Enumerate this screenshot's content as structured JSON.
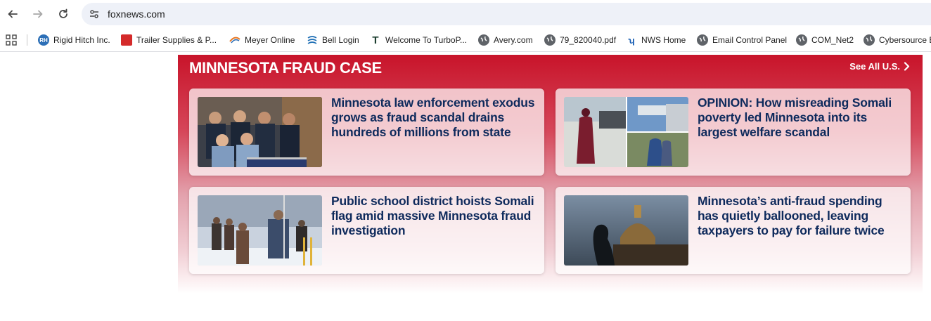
{
  "browser": {
    "url": "foxnews.com",
    "bookmarks": [
      {
        "label": "Rigid Hitch Inc.",
        "icon": "rigid-hitch-favicon",
        "color": "#2c6fb7"
      },
      {
        "label": "Trailer Supplies & P...",
        "icon": "trailer-supplies-favicon",
        "color": "#d42a2a"
      },
      {
        "label": "Meyer Online",
        "icon": "meyer-favicon",
        "color": "#e87722"
      },
      {
        "label": "Bell Login",
        "icon": "bell-favicon",
        "color": "#1f6fb5"
      },
      {
        "label": "Welcome To TurboP...",
        "icon": "turbo-favicon",
        "color": "#1b3d2f"
      },
      {
        "label": "Avery.com",
        "icon": "globe-icon",
        "color": "#5f6368"
      },
      {
        "label": "79_820040.pdf",
        "icon": "globe-icon",
        "color": "#5f6368"
      },
      {
        "label": "NWS Home",
        "icon": "nws-favicon",
        "color": "#1a5fb4"
      },
      {
        "label": "Email Control Panel",
        "icon": "globe-icon",
        "color": "#5f6368"
      },
      {
        "label": "COM_Net2",
        "icon": "globe-icon",
        "color": "#5f6368"
      },
      {
        "label": "Cybersource B",
        "icon": "globe-icon",
        "color": "#5f6368"
      }
    ]
  },
  "section": {
    "title": "MINNESOTA FRAUD CASE",
    "see_all": "See All U.S.",
    "accent": "#c8142a"
  },
  "cards": [
    {
      "headline": "Minnesota law enforcement exodus grows as fraud scandal drains hundreds of millions from state"
    },
    {
      "headline": "OPINION: How misreading Somali poverty led Minnesota into its largest welfare scandal"
    },
    {
      "headline": "Public school district hoists Somali flag amid massive Minnesota fraud investigation"
    },
    {
      "headline": "Minnesota’s anti-fraud spending has quietly ballooned, leaving taxpayers to pay for failure twice"
    }
  ]
}
